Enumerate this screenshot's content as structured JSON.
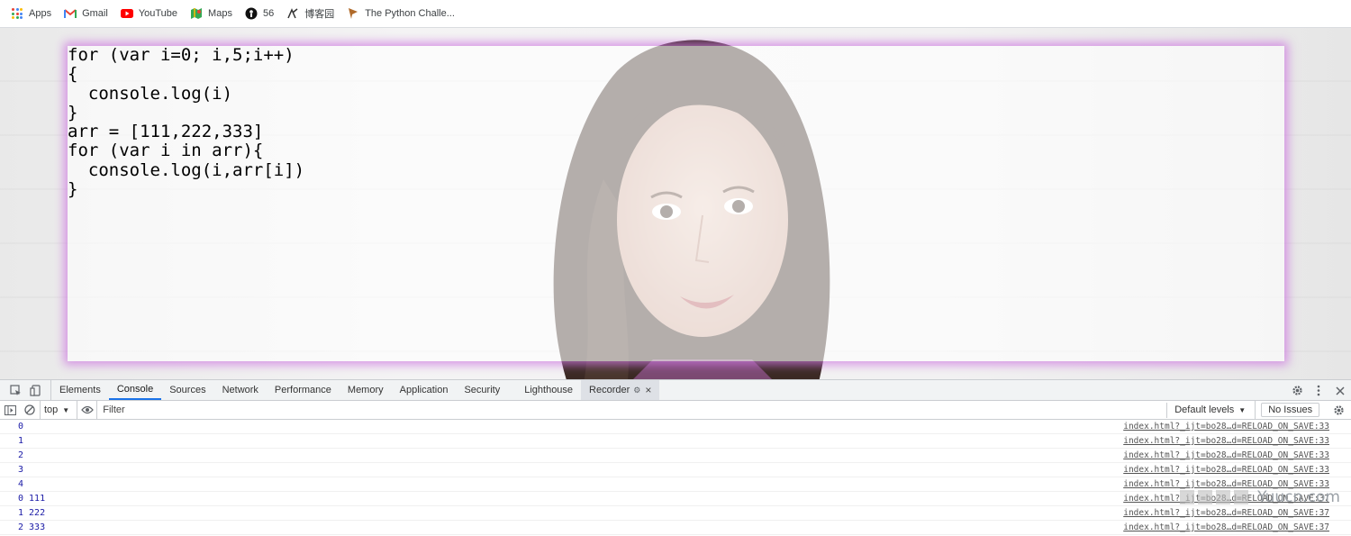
{
  "bookmarks": [
    {
      "label": "Apps",
      "icon": "apps-grid-icon"
    },
    {
      "label": "Gmail",
      "icon": "gmail-icon"
    },
    {
      "label": "YouTube",
      "icon": "youtube-icon"
    },
    {
      "label": "Maps",
      "icon": "maps-icon"
    },
    {
      "label": "56",
      "icon": "56-icon"
    },
    {
      "label": "博客园",
      "icon": "cnblogs-icon"
    },
    {
      "label": "The Python Challe...",
      "icon": "python-challenge-icon"
    }
  ],
  "page": {
    "code": "for (var i=0; i,5;i++)\n{\n  console.log(i)\n}\narr = [111,222,333]\nfor (var i in arr){\n  console.log(i,arr[i])\n}"
  },
  "devtools": {
    "tabs": [
      {
        "label": "Elements",
        "active": false
      },
      {
        "label": "Console",
        "active": true
      },
      {
        "label": "Sources",
        "active": false
      },
      {
        "label": "Network",
        "active": false
      },
      {
        "label": "Performance",
        "active": false
      },
      {
        "label": "Memory",
        "active": false
      },
      {
        "label": "Application",
        "active": false
      },
      {
        "label": "Security",
        "active": false
      },
      {
        "label": "Lighthouse",
        "active": false
      },
      {
        "label": "Recorder",
        "active": false
      }
    ],
    "toolbar": {
      "context": "top",
      "filter_placeholder": "Filter",
      "levels": "Default levels",
      "issues": "No Issues"
    },
    "console_rows": [
      {
        "message": "0",
        "source": "index.html?_ijt=bo28…d=RELOAD_ON_SAVE:33"
      },
      {
        "message": "1",
        "source": "index.html?_ijt=bo28…d=RELOAD_ON_SAVE:33"
      },
      {
        "message": "2",
        "source": "index.html?_ijt=bo28…d=RELOAD_ON_SAVE:33"
      },
      {
        "message": "3",
        "source": "index.html?_ijt=bo28…d=RELOAD_ON_SAVE:33"
      },
      {
        "message": "4",
        "source": "index.html?_ijt=bo28…d=RELOAD_ON_SAVE:33"
      },
      {
        "message": "0 111",
        "source": "index.html?_ijt=bo28…d=RELOAD_ON_SAVE:37"
      },
      {
        "message": "1 222",
        "source": "index.html?_ijt=bo28…d=RELOAD_ON_SAVE:37"
      },
      {
        "message": "2 333",
        "source": "index.html?_ijt=bo28…d=RELOAD_ON_SAVE:37"
      }
    ]
  },
  "watermark": {
    "text": "Yuucn.com"
  },
  "colors": {
    "panel_glow": "#ce78e0",
    "active_tab_underline": "#1a73e8",
    "console_text": "#1a1aa6"
  }
}
